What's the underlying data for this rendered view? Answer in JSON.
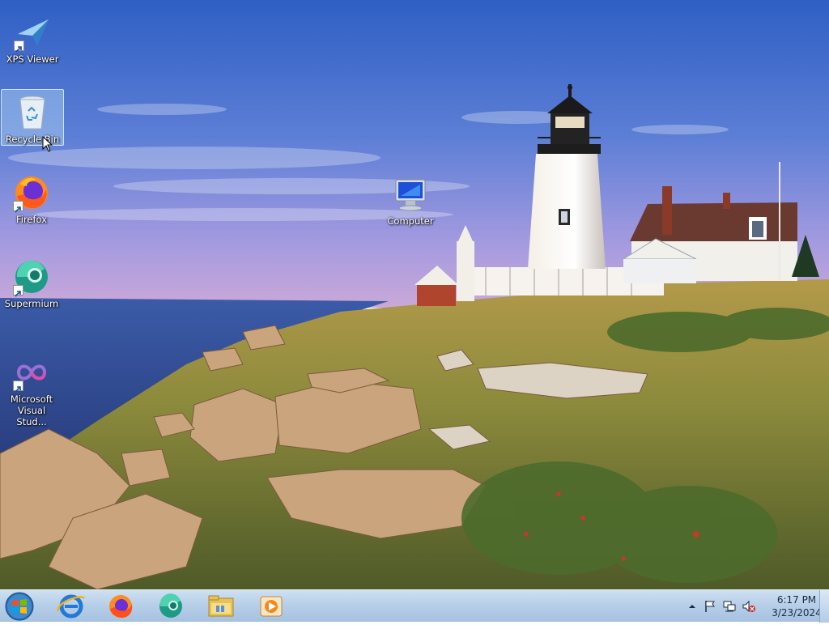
{
  "desktop": {
    "icons": [
      {
        "label": "XPS Viewer"
      },
      {
        "label": "Recycle Bin"
      },
      {
        "label": "Firefox"
      },
      {
        "label": "Supermium"
      },
      {
        "label": "Microsoft Visual Stud..."
      },
      {
        "label": "Computer"
      }
    ]
  },
  "taskbar": {
    "pinned": [
      {
        "icon": "internet-explorer-icon"
      },
      {
        "icon": "firefox-icon"
      },
      {
        "icon": "supermium-icon"
      },
      {
        "icon": "file-explorer-icon"
      },
      {
        "icon": "media-player-icon"
      }
    ]
  },
  "tray": {
    "time": "6:17 PM",
    "date": "3/23/2024"
  }
}
